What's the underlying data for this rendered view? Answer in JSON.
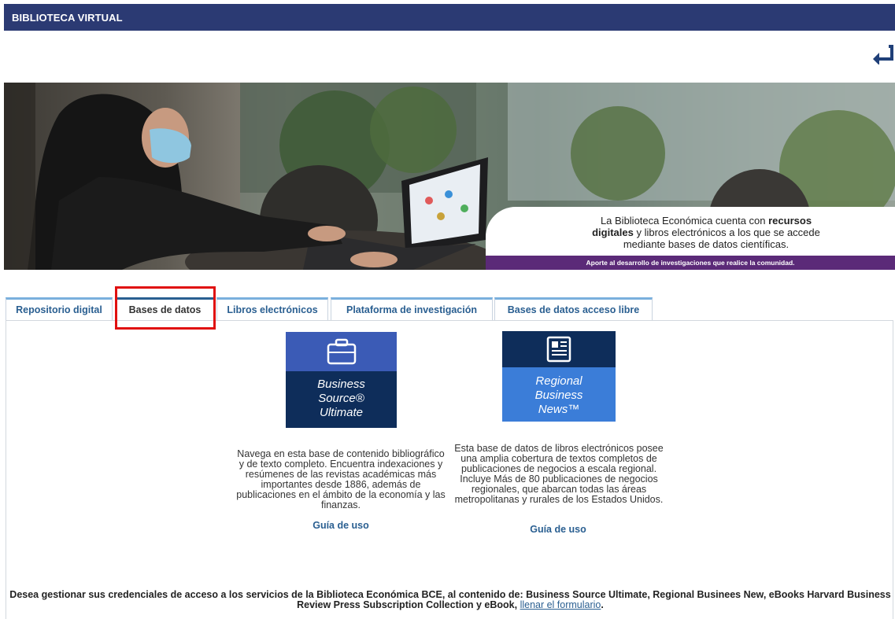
{
  "header": {
    "title": "BIBLIOTECA VIRTUAL",
    "back_icon": "return-arrow-icon"
  },
  "hero": {
    "caption_pre": "La Biblioteca Económica cuenta con ",
    "caption_bold1": "recursos",
    "caption_bold2": "digitales",
    "caption_mid": " y libros electrónicos a los que se accede",
    "caption_end": "mediante bases de datos científicas.",
    "strip": "Aporte al desarrollo de investigaciones que realice la comunidad.",
    "colors": {
      "strip": "#5b2a78"
    }
  },
  "tabs": [
    {
      "label": "Repositorio digital",
      "active": false
    },
    {
      "label": "Bases de datos",
      "active": true
    },
    {
      "label": "Libros electrónicos",
      "active": false
    },
    {
      "label": "Plataforma de investigación",
      "active": false
    },
    {
      "label": "Bases de datos acceso libre",
      "active": false
    }
  ],
  "databases": [
    {
      "title_lines": [
        "Business",
        "Source®",
        "Ultimate"
      ],
      "icon": "briefcase-icon",
      "description": "Navega en esta base de contenido bibliográfico y de texto completo. Encuentra indexaciones y resúmenes de las revistas académicas más importantes desde 1886, además de publicaciones en el ámbito de la economía y las finanzas.",
      "guide": "Guía de uso"
    },
    {
      "title_lines": [
        "Regional",
        "Business",
        "News™"
      ],
      "icon": "newspaper-icon",
      "description": "Esta base de datos de libros electrónicos posee una amplia cobertura de textos completos de publicaciones de negocios a escala regional. Incluye Más de 80 publicaciones de negocios regionales, que abarcan todas las áreas metropolitanas y rurales de los Estados Unidos.",
      "guide": "Guía de uso"
    }
  ],
  "footer": {
    "text": "Desea gestionar sus credenciales de acceso a los servicios de la Biblioteca Económica BCE, al contenido de: Business Source Ultimate, Regional Businees New, eBooks Harvard Business Review Press Subscription Collection y eBook,",
    "link": "llenar el formulario",
    "tail": "."
  }
}
